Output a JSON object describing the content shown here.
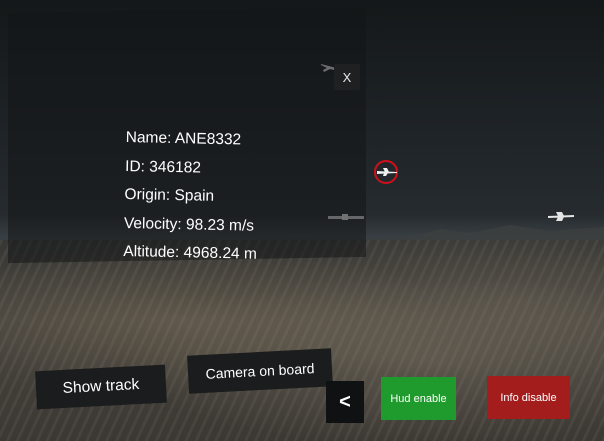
{
  "info_panel": {
    "close_label": "X",
    "lines": [
      "Name: ANE8332",
      "ID: 346182",
      "Origin: Spain",
      "Velocity: 98.23 m/s",
      "Altitude: 4968.24 m"
    ]
  },
  "controls": {
    "show_track": "Show track",
    "camera_on_board": "Camera on board",
    "back": "<",
    "hud_enable": "Hud enable",
    "info_disable": "Info disable"
  },
  "colors": {
    "hud_enable_bg": "#1f9a2c",
    "info_disable_bg": "#a41d1d",
    "target_ring": "#d0101a"
  },
  "icons": {
    "aircraft": "airplane-icon",
    "target": "target-ring-icon"
  }
}
